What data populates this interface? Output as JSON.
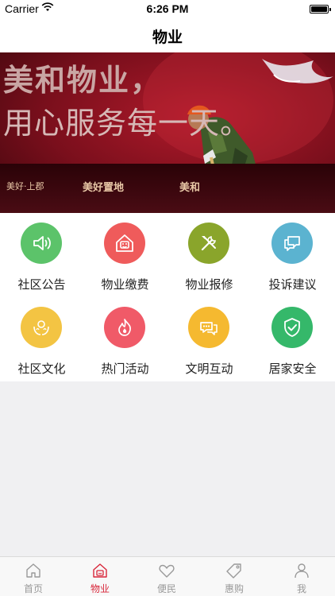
{
  "status_bar": {
    "carrier": "Carrier",
    "time": "6:26 PM"
  },
  "nav": {
    "title": "物业"
  },
  "banner": {
    "headline": "美和物业，",
    "tagline": "用心服务每一天。",
    "brands": [
      "美好·上郡",
      "美好置地",
      "美和"
    ]
  },
  "services": [
    {
      "label": "社区公告",
      "icon": "speaker-icon",
      "color": "#5cc36a"
    },
    {
      "label": "物业缴费",
      "icon": "house-payment-icon",
      "color": "#ef5b5b"
    },
    {
      "label": "物业报修",
      "icon": "tools-icon",
      "color": "#8aa52b"
    },
    {
      "label": "投诉建议",
      "icon": "chat-bubbles-icon",
      "color": "#5bb3d0"
    },
    {
      "label": "社区文化",
      "icon": "hands-icon",
      "color": "#f3c443"
    },
    {
      "label": "热门活动",
      "icon": "flame-icon",
      "color": "#f05a68"
    },
    {
      "label": "文明互动",
      "icon": "speech-icon",
      "color": "#f5b930"
    },
    {
      "label": "居家安全",
      "icon": "shield-check-icon",
      "color": "#35b86a"
    }
  ],
  "tabs": [
    {
      "label": "首页",
      "icon": "home-icon",
      "active": false
    },
    {
      "label": "物业",
      "icon": "property-icon",
      "active": true
    },
    {
      "label": "便民",
      "icon": "heart-icon",
      "active": false
    },
    {
      "label": "惠购",
      "icon": "tag-icon",
      "active": false
    },
    {
      "label": "我",
      "icon": "person-icon",
      "active": false
    }
  ],
  "colors": {
    "accent": "#d8263a",
    "tab_inactive": "#999999",
    "background": "#f0f0f2"
  }
}
